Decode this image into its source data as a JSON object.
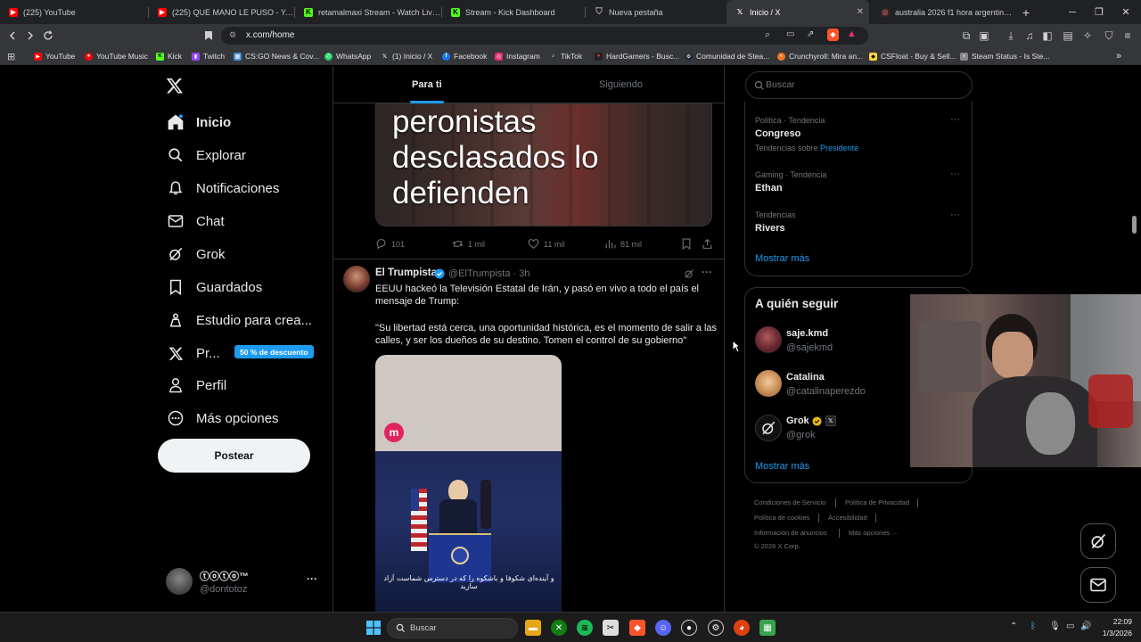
{
  "browser": {
    "tabs": [
      {
        "label": "(225) YouTube",
        "icon": "youtube-icon",
        "color": "#ff0000"
      },
      {
        "label": "(225) QUE MANO LE PUSO - YouTub",
        "icon": "youtube-icon",
        "color": "#ff0000"
      },
      {
        "label": "retamalmaxi Stream - Watch Live on",
        "icon": "kick-icon",
        "color": "#53fc18"
      },
      {
        "label": "Stream - Kick Dashboard",
        "icon": "kick-icon",
        "color": "#53fc18"
      },
      {
        "label": "Nueva pestaña",
        "icon": "shield-icon",
        "color": "#aaaaaa"
      },
      {
        "label": "Inicio / X",
        "icon": "x-icon",
        "color": "#ffffff"
      },
      {
        "label": "australia 2026 f1 hora argentina - Br",
        "icon": "search-icon",
        "color": "#ff6b6b"
      }
    ],
    "tab_close": "✕",
    "new_tab": "+",
    "url": "x.com/home",
    "bookmarks": [
      {
        "label": "YouTube",
        "color": "#ff0000"
      },
      {
        "label": "YouTube Music",
        "color": "#ff0000"
      },
      {
        "label": "Kick",
        "color": "#53fc18"
      },
      {
        "label": "Twitch",
        "color": "#9146ff"
      },
      {
        "label": "CS:GO News & Cov...",
        "color": "#4a90d9"
      },
      {
        "label": "WhatsApp",
        "color": "#25d366"
      },
      {
        "label": "(1) Inicio / X",
        "color": "#ffffff"
      },
      {
        "label": "Facebook",
        "color": "#1877f2"
      },
      {
        "label": "Instagram",
        "color": "#e1306c"
      },
      {
        "label": "TikTok",
        "color": "#ffffff"
      },
      {
        "label": "HardGamers - Busc...",
        "color": "#222222"
      },
      {
        "label": "Comunidad de Stea...",
        "color": "#1b2838"
      },
      {
        "label": "Crunchyroll: Mira an...",
        "color": "#f47521"
      },
      {
        "label": "CSFloat - Buy & Sell...",
        "color": "#ffd43b"
      },
      {
        "label": "Steam Status - Is Ste...",
        "color": "#888888"
      }
    ]
  },
  "sidebar": {
    "items": [
      {
        "label": "Inicio",
        "icon": "home-icon"
      },
      {
        "label": "Explorar",
        "icon": "search-icon"
      },
      {
        "label": "Notificaciones",
        "icon": "bell-icon"
      },
      {
        "label": "Chat",
        "icon": "mail-icon"
      },
      {
        "label": "Grok",
        "icon": "grok-icon"
      },
      {
        "label": "Guardados",
        "icon": "bookmark-icon"
      },
      {
        "label": "Estudio para crea...",
        "icon": "studio-icon"
      },
      {
        "label": "Pr...",
        "icon": "x-premium-icon"
      },
      {
        "label": "Perfil",
        "icon": "profile-icon"
      },
      {
        "label": "Más opciones",
        "icon": "more-icon"
      }
    ],
    "discount_badge": "50 % de descuento",
    "post_button": "Postear",
    "account": {
      "name": "ⓣⓞⓣⓞ™",
      "handle": "@dontotoz",
      "more": "···"
    }
  },
  "feed": {
    "tabs": [
      "Para ti",
      "Siguiendo"
    ],
    "tweet1": {
      "image_headline": [
        "peronistas",
        "desclasados lo",
        "defienden"
      ],
      "replies": "101",
      "retweets": "1 mil",
      "likes": "11 mil",
      "views": "81 mil"
    },
    "tweet2": {
      "name": "El Trumpista",
      "handle": "@ElTrumpista · 3h",
      "text1": "EEUU hackeó la Televisión Estatal de Irán, y pasó en vivo a todo el país el mensaje de Trump:",
      "text2": "\"Su libertad está cerca, una oportunidad histórica, es el momento de salir a las calles, y ser los dueños de su destino. Tomen el control de su gobierno\"",
      "media_caption": "و آینده‌ای شکوفا و باشکوه را که در دسترس شماست آزاد سازید"
    }
  },
  "right": {
    "search_placeholder": "Buscar",
    "trends": [
      {
        "meta": "Política · Tendencia",
        "title": "Congreso",
        "sub_prefix": "Tendencias sobre ",
        "sub_link": "Presidente"
      },
      {
        "meta": "Gaming · Tendencia",
        "title": "Ethan"
      },
      {
        "meta": "Tendencias",
        "title": "Rivers"
      }
    ],
    "show_more": "Mostrar más",
    "who_to_follow": "A quién seguir",
    "follow": [
      {
        "name": "saje.kmd",
        "handle": "@sajekmd"
      },
      {
        "name": "Catalina",
        "handle": "@catalinaperezdo"
      },
      {
        "name": "Grok",
        "handle": "@grok",
        "badge": "𝕏"
      }
    ],
    "show_more_2": "Mostrar más",
    "footer": [
      "Condiciones de Servicio",
      "Política de Privacidad",
      "Política de cookies",
      "Accesibilidad",
      "Información de anuncios",
      "Más opciones ···",
      "© 2026 X Corp."
    ]
  },
  "taskbar": {
    "search": "Buscar",
    "time": "22:09",
    "date": "1/3/2026"
  }
}
